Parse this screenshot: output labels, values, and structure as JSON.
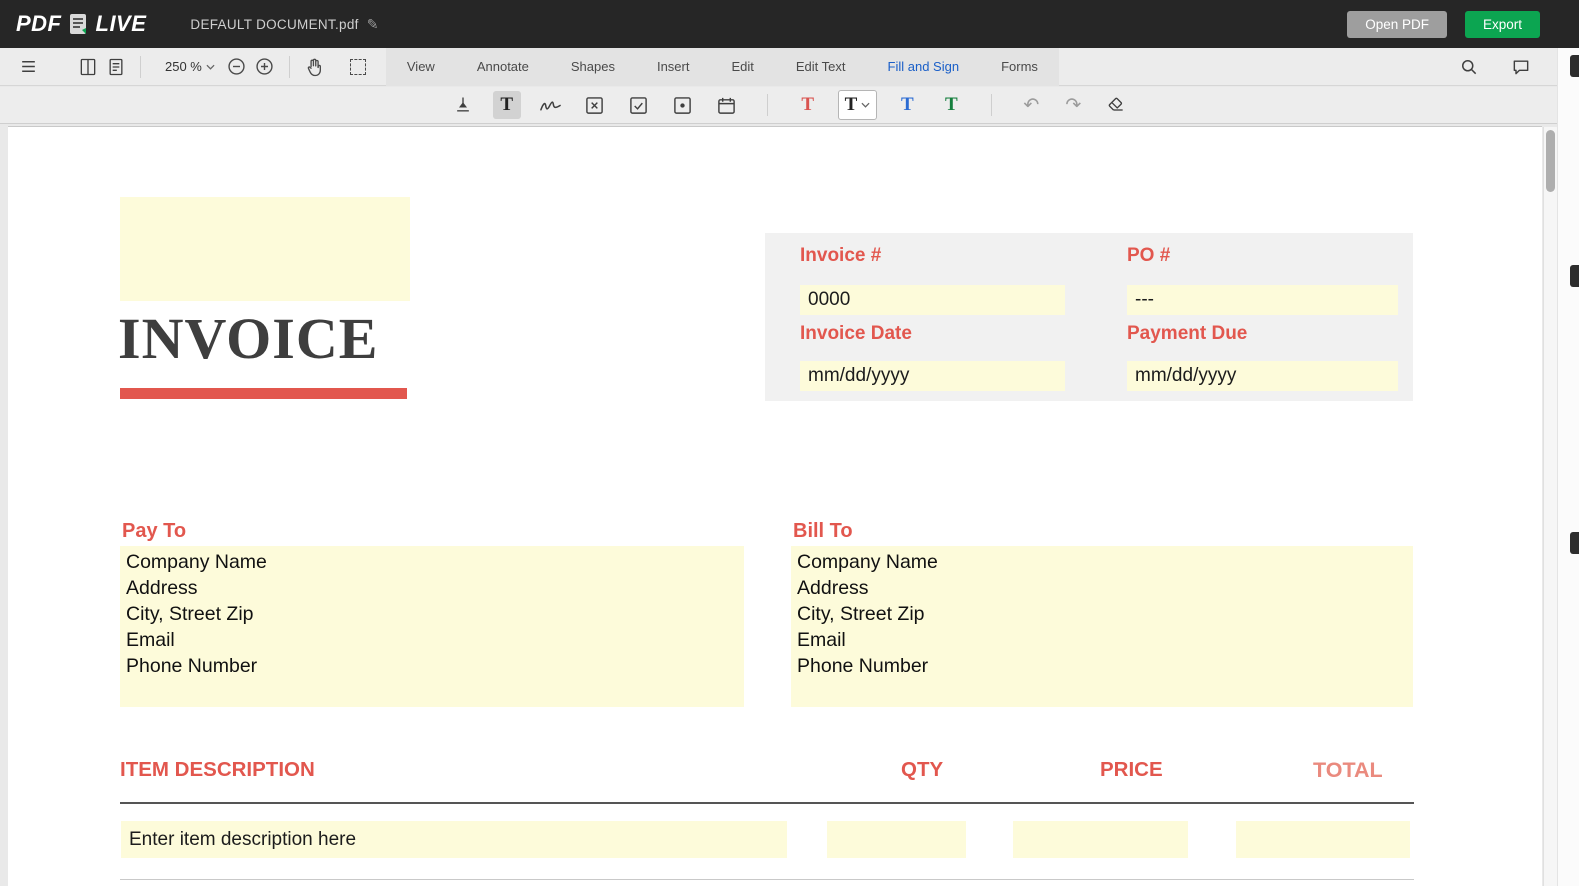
{
  "colors": {
    "topbar_bg": "#262626",
    "export_green": "#0ca551",
    "open_gray": "#9e9e9e",
    "accent_red": "#e2574e",
    "total_header_red": "#ea8a7e",
    "field_yellow": "#fdfbda",
    "active_tab_blue": "#1a5fc8",
    "text_tool_red": "#d9534f",
    "text_tool_black": "#222222",
    "text_tool_blue": "#2b6bd3",
    "text_tool_green": "#157f3d"
  },
  "topbar": {
    "logo_pdf": "PDF",
    "logo_live": "LIVE",
    "doc_title": "DEFAULT DOCUMENT.pdf",
    "open_pdf_label": "Open PDF",
    "export_label": "Export"
  },
  "toolbar": {
    "zoom_value": "250 %",
    "tabs": [
      {
        "label": "View"
      },
      {
        "label": "Annotate"
      },
      {
        "label": "Shapes"
      },
      {
        "label": "Insert"
      },
      {
        "label": "Edit"
      },
      {
        "label": "Edit Text"
      },
      {
        "label": "Fill and Sign"
      },
      {
        "label": "Forms"
      }
    ]
  },
  "fill_sign": {
    "letter": "T"
  },
  "invoice": {
    "title": "INVOICE",
    "header": {
      "invoice_no_label": "Invoice #",
      "invoice_no_value": "0000",
      "po_label": "PO #",
      "po_value": "---",
      "date_label": "Invoice Date",
      "date_value": "mm/dd/yyyy",
      "due_label": "Payment Due",
      "due_value": "mm/dd/yyyy"
    },
    "pay_to": {
      "label": "Pay To",
      "lines": [
        "Company Name",
        "Address",
        "City, Street Zip",
        "Email",
        "Phone Number"
      ]
    },
    "bill_to": {
      "label": "Bill To",
      "lines": [
        "Company Name",
        "Address",
        "City, Street Zip",
        "Email",
        "Phone Number"
      ]
    },
    "table": {
      "col_description": "ITEM DESCRIPTION",
      "col_qty": "QTY",
      "col_price": "PRICE",
      "col_total": "TOTAL",
      "row_description_value": "Enter item description here"
    }
  }
}
